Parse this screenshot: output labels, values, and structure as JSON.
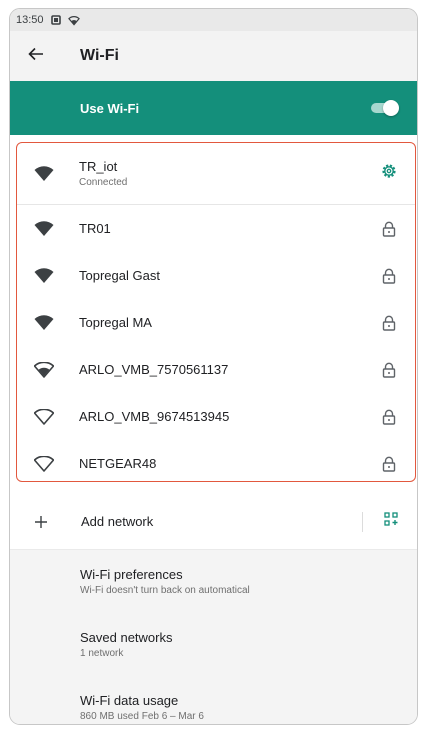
{
  "status_bar": {
    "time": "13:50",
    "icons": [
      "notification-square-icon",
      "wifi-status-icon"
    ]
  },
  "app_bar": {
    "back_icon": "arrow-left-icon",
    "title": "Wi-Fi"
  },
  "master_switch": {
    "label": "Use Wi-Fi",
    "enabled": true,
    "color": "#148f7b"
  },
  "networks": [
    {
      "name": "TR_iot",
      "status": "Connected",
      "signal": "filled",
      "action_icon": "gear-icon"
    },
    {
      "name": "TR01",
      "signal": "filled",
      "action_icon": "lock-icon"
    },
    {
      "name": "Topregal Gast",
      "signal": "filled",
      "action_icon": "lock-icon"
    },
    {
      "name": "Topregal MA",
      "signal": "filled",
      "action_icon": "lock-icon"
    },
    {
      "name": "ARLO_VMB_7570561137",
      "signal": "partial",
      "action_icon": "lock-icon"
    },
    {
      "name": "ARLO_VMB_9674513945",
      "signal": "outline",
      "action_icon": "lock-icon"
    },
    {
      "name": "NETGEAR48",
      "signal": "outline",
      "action_icon": "lock-icon"
    }
  ],
  "highlight_color": "#e2583e",
  "add_network": {
    "label": "Add network",
    "icon": "plus-icon",
    "qr_icon": "qr-scan-icon"
  },
  "preferences": [
    {
      "title": "Wi-Fi preferences",
      "subtitle": "Wi-Fi doesn't turn back on automatical"
    },
    {
      "title": "Saved networks",
      "subtitle": "1 network"
    },
    {
      "title": "Wi-Fi data usage",
      "subtitle": "860 MB used Feb 6 – Mar 6"
    }
  ]
}
